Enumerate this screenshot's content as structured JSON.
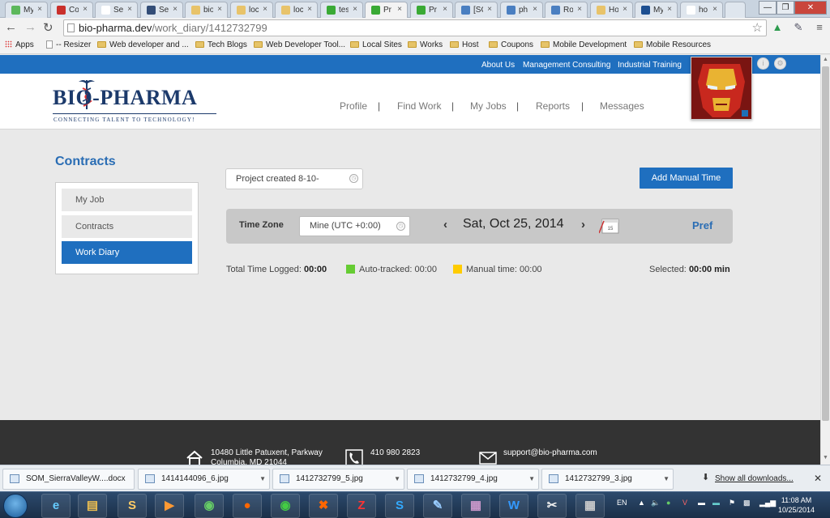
{
  "browser": {
    "tabs": [
      {
        "label": "My",
        "fav": "#5cb85c"
      },
      {
        "label": "Co",
        "fav": "#c9302c"
      },
      {
        "label": "Se",
        "fav": "#ffffff"
      },
      {
        "label": "Se",
        "fav": "#334d77"
      },
      {
        "label": "bio",
        "fav": "#e8c36a"
      },
      {
        "label": "loc",
        "fav": "#e8c36a"
      },
      {
        "label": "loc",
        "fav": "#e8c36a"
      },
      {
        "label": "tes",
        "fav": "#3aaa35"
      },
      {
        "label": "Pr",
        "fav": "#3aaa35"
      },
      {
        "label": "Pr",
        "fav": "#3aaa35"
      },
      {
        "label": "[SC",
        "fav": "#4a7fc1"
      },
      {
        "label": "ph",
        "fav": "#4a7fc1"
      },
      {
        "label": "Ro",
        "fav": "#4a7fc1"
      },
      {
        "label": "Ho",
        "fav": "#e8c36a"
      },
      {
        "label": "My",
        "fav": "#1d4f91"
      },
      {
        "label": "ho",
        "fav": "#ffffff"
      }
    ],
    "url_host": "bio-pharma.dev",
    "url_path": "/work_diary/1412732799",
    "bookmarks": [
      "Apps",
      "-- Resizer",
      "Web developer and ...",
      "Tech Blogs",
      "Web Developer Tool...",
      "Local Sites",
      "Works",
      "Host",
      "Coupons",
      "Mobile Development",
      "Mobile Resources"
    ]
  },
  "site": {
    "top_links": [
      "About Us",
      "Management Consulting",
      "Industrial Training"
    ],
    "logo": {
      "wordmark": "BIO-PHARMA",
      "tagline": "CONNECTING TALENT TO TECHNOLOGY!"
    },
    "nav": [
      "Profile",
      "Find Work",
      "My Jobs",
      "Reports",
      "Messages"
    ],
    "section_title": "Contracts",
    "sidebar": [
      "My Job",
      "Contracts",
      "Work Diary"
    ],
    "project_select": "Project created 8-10-",
    "add_manual_time": "Add Manual Time",
    "timezone": {
      "label": "Time Zone",
      "value": "Mine (UTC +0:00)"
    },
    "date": "Sat, Oct 25, 2014",
    "calendar_day": "15",
    "pref": "Pref",
    "stats": {
      "total_label": "Total Time Logged:",
      "total_value": "00:00",
      "auto_label": "Auto-tracked: 00:00",
      "manual_label": "Manual time: 00:00",
      "selected_label": "Selected:",
      "selected_value": "00:00 min",
      "auto_color": "#66cc33",
      "manual_color": "#ffcc00"
    },
    "footer": {
      "address_line1": "10480 Little Patuxent, Parkway",
      "address_line2": "Columbia, MD 21044",
      "phone": "410 980 2823",
      "email": "support@bio-pharma.com"
    }
  },
  "downloads": {
    "items": [
      "SOM_SierraValleyW....docx",
      "1414144096_6.jpg",
      "1412732799_5.jpg",
      "1412732799_4.jpg",
      "1412732799_3.jpg"
    ],
    "show_all": "Show all downloads..."
  },
  "taskbar": {
    "lang": "EN",
    "time": "11:08 AM",
    "date": "10/25/2014"
  },
  "colors": {
    "brand_blue": "#1f6fbf",
    "link_blue": "#2a6db4",
    "footer": "#333333"
  }
}
